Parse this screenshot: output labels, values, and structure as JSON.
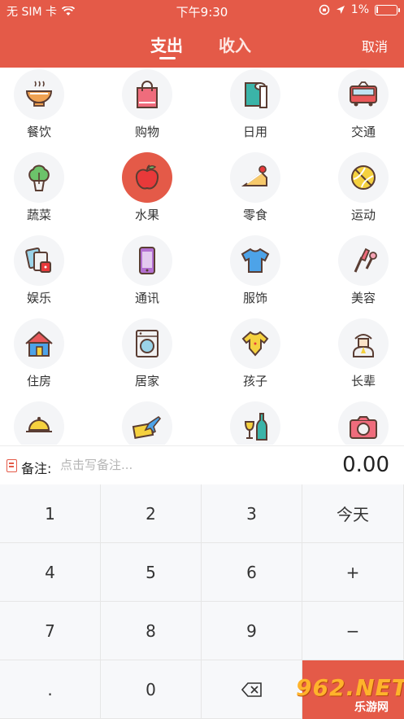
{
  "status_bar": {
    "carrier": "无 SIM 卡",
    "time": "下午9:30",
    "battery": "1%",
    "battery_level": 0.01
  },
  "header": {
    "tabs": [
      {
        "label": "支出",
        "active": true
      },
      {
        "label": "收入",
        "active": false
      }
    ],
    "cancel_label": "取消"
  },
  "categories": [
    {
      "label": "餐饮",
      "icon": "bowl-icon"
    },
    {
      "label": "购物",
      "icon": "shopping-bag-icon"
    },
    {
      "label": "日用",
      "icon": "paper-roll-icon"
    },
    {
      "label": "交通",
      "icon": "train-icon"
    },
    {
      "label": "蔬菜",
      "icon": "vegetable-icon"
    },
    {
      "label": "水果",
      "icon": "apple-icon",
      "selected": true
    },
    {
      "label": "零食",
      "icon": "cake-icon"
    },
    {
      "label": "运动",
      "icon": "tennis-ball-icon"
    },
    {
      "label": "娱乐",
      "icon": "cards-dice-icon"
    },
    {
      "label": "通讯",
      "icon": "phone-icon"
    },
    {
      "label": "服饰",
      "icon": "tshirt-icon"
    },
    {
      "label": "美容",
      "icon": "makeup-brush-icon"
    },
    {
      "label": "住房",
      "icon": "house-icon"
    },
    {
      "label": "居家",
      "icon": "washing-machine-icon"
    },
    {
      "label": "孩子",
      "icon": "baby-clothes-icon"
    },
    {
      "label": "长辈",
      "icon": "elder-icon"
    },
    {
      "label": "",
      "icon": "dining-icon"
    },
    {
      "label": "",
      "icon": "travel-ticket-icon"
    },
    {
      "label": "",
      "icon": "wine-icon"
    },
    {
      "label": "",
      "icon": "camera-icon"
    }
  ],
  "remark": {
    "label": "备注:",
    "placeholder": "点击写备注...",
    "amount": "0.00"
  },
  "keypad": {
    "keys": [
      "1",
      "2",
      "3",
      "今天",
      "4",
      "5",
      "6",
      "+",
      "7",
      "8",
      "9",
      "−",
      ".",
      "0",
      "",
      ""
    ],
    "icons": {
      "backspace": "backspace-icon"
    }
  },
  "watermark": {
    "brand": "962.NET",
    "sub": "乐游网"
  },
  "colors": {
    "accent": "#e45a48",
    "icon_bg": "#f4f5f7"
  }
}
